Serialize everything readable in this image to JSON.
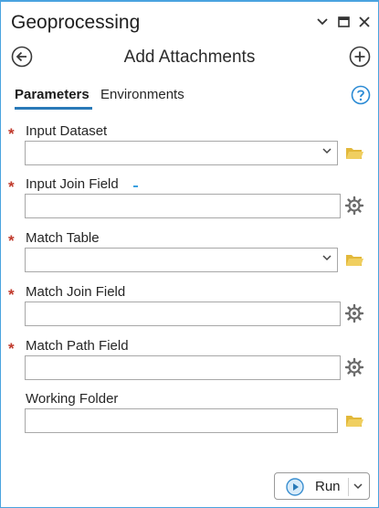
{
  "pane": {
    "title": "Geoprocessing",
    "tool_title": "Add Attachments"
  },
  "tabs": [
    {
      "label": "Parameters",
      "active": true
    },
    {
      "label": "Environments",
      "active": false
    }
  ],
  "parameters": [
    {
      "label": "Input Dataset",
      "required": true,
      "type": "dropdown",
      "value": "",
      "side_icon": "folder-icon"
    },
    {
      "label": "Input Join Field",
      "required": true,
      "type": "text",
      "value": "",
      "side_icon": "gear-icon"
    },
    {
      "label": "Match Table",
      "required": true,
      "type": "dropdown",
      "value": "",
      "side_icon": "folder-icon"
    },
    {
      "label": "Match Join Field",
      "required": true,
      "type": "text",
      "value": "",
      "side_icon": "gear-icon"
    },
    {
      "label": "Match Path Field",
      "required": true,
      "type": "text",
      "value": "",
      "side_icon": "gear-icon"
    },
    {
      "label": "Working Folder",
      "required": false,
      "type": "text",
      "value": "",
      "side_icon": "folder-icon"
    }
  ],
  "required_marker": "*",
  "run_button": {
    "label": "Run"
  },
  "colors": {
    "accent": "#2a7ab8",
    "border": "#4aa3df",
    "required": "#c0392b",
    "folder": "#e2b83a",
    "gear": "#6b6b6b"
  }
}
